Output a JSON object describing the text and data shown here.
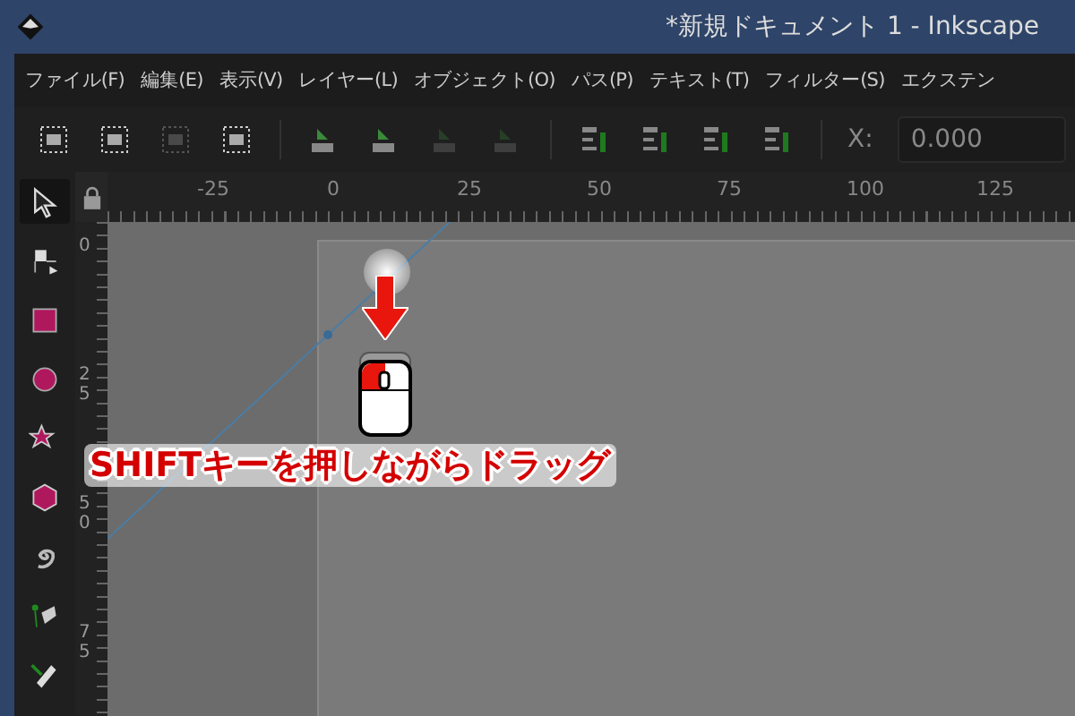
{
  "window": {
    "title": "*新規ドキュメント 1 - Inkscape"
  },
  "menu": [
    {
      "label": "ファイル(F)"
    },
    {
      "label": "編集(E)"
    },
    {
      "label": "表示(V)"
    },
    {
      "label": "レイヤー(L)"
    },
    {
      "label": "オブジェクト(O)"
    },
    {
      "label": "パス(P)"
    },
    {
      "label": "テキスト(T)"
    },
    {
      "label": "フィルター(S)"
    },
    {
      "label": "エクステン"
    }
  ],
  "toolbar": {
    "buttons": [
      {
        "kind": "select-all",
        "disabled": false
      },
      {
        "kind": "select-all-layers",
        "disabled": false
      },
      {
        "kind": "deselect",
        "disabled": true
      },
      {
        "kind": "touch-select",
        "disabled": false
      },
      {
        "kind": "rotate-left",
        "disabled": false
      },
      {
        "kind": "rotate-right",
        "disabled": false
      },
      {
        "kind": "flip-h",
        "disabled": true
      },
      {
        "kind": "flip-v",
        "disabled": true
      },
      {
        "kind": "raise-top",
        "disabled": false
      },
      {
        "kind": "raise",
        "disabled": false
      },
      {
        "kind": "lower",
        "disabled": false
      },
      {
        "kind": "lower-bottom",
        "disabled": false
      }
    ],
    "x_label": "X:",
    "x_value": "0.000"
  },
  "ruler_h": [
    "-25",
    "0",
    "25",
    "50",
    "75",
    "100",
    "125"
  ],
  "ruler_v": [
    "0",
    "25",
    "50",
    "75"
  ],
  "tools": [
    {
      "kind": "selector",
      "selected": true
    },
    {
      "kind": "node",
      "selected": false
    },
    {
      "kind": "rect",
      "selected": false
    },
    {
      "kind": "circle",
      "selected": false
    },
    {
      "kind": "star",
      "selected": false
    },
    {
      "kind": "box3d",
      "selected": false
    },
    {
      "kind": "spiral",
      "selected": false
    },
    {
      "kind": "pen",
      "selected": false
    },
    {
      "kind": "pencil",
      "selected": false
    }
  ],
  "annotation": {
    "text": "SHIFTキーを押しながらドラッグ"
  }
}
